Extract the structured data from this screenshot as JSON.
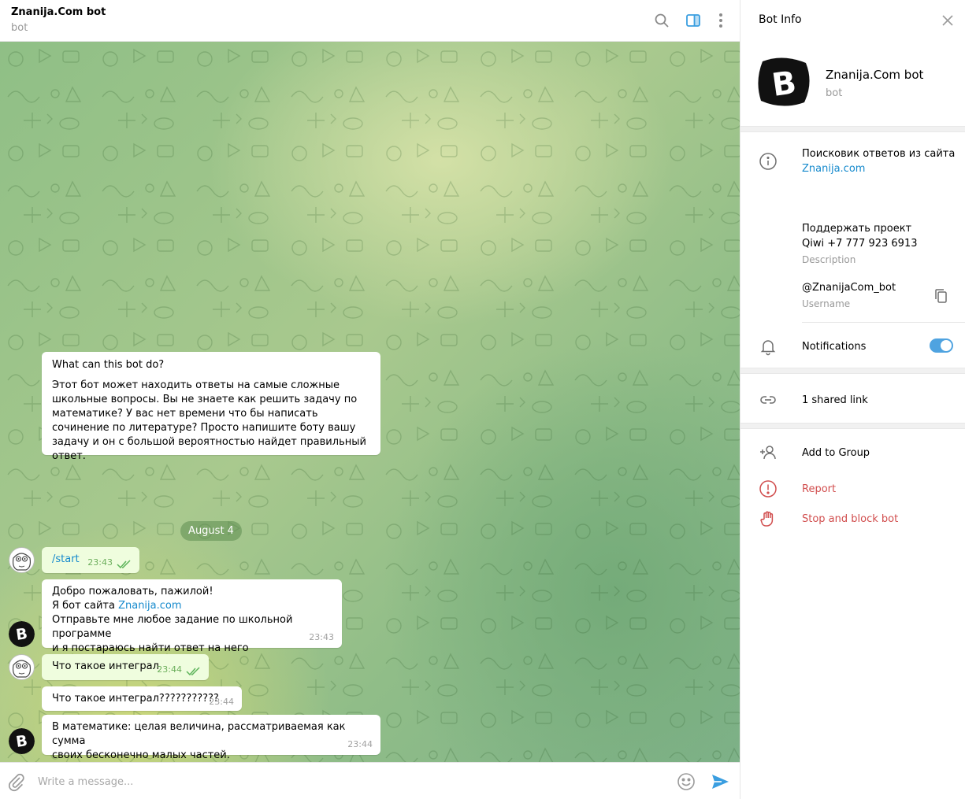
{
  "header": {
    "title": "Znanija.Com bot",
    "subtitle": "bot",
    "icons": [
      "search-icon",
      "sidebar-toggle-icon",
      "more-vertical-icon"
    ]
  },
  "chat": {
    "intro": {
      "title": "What can this bot do?",
      "text": "Этот бот может находить ответы на самые сложные школьные вопросы. Вы не знаете как решить задачу по математике? У вас нет времени что бы написать сочинение по литературе? Просто напишите боту вашу задачу и он с большой вероятностью найдет правильный ответ."
    },
    "date_separator": "August 4",
    "messages": [
      {
        "from": "user",
        "text": "/start",
        "time": "23:43",
        "status": "read"
      },
      {
        "from": "bot",
        "line1": "Добро пожаловать, пажилой!",
        "line2_prefix": "Я бот сайта ",
        "line2_link": "Znanija.com",
        "line3": "Отправьте мне любое задание по школьной программе",
        "line4": "и я постараюсь найти ответ на него",
        "time": "23:43"
      },
      {
        "from": "user",
        "text": "Что такое интеграл",
        "time": "23:44",
        "status": "read"
      },
      {
        "from": "bot",
        "text": "Что такое интеграл???????????",
        "time": "23:44"
      },
      {
        "from": "bot",
        "line1": "В математике: целая величина, рассматриваемая как сумма",
        "line2": "своих бесконечно малых частей.",
        "time": "23:44"
      }
    ]
  },
  "composer": {
    "placeholder": "Write a message...",
    "icons": [
      "attach-icon",
      "emoji-icon",
      "send-icon"
    ]
  },
  "panel": {
    "title": "Bot Info",
    "bot_name": "Znanija.Com bot",
    "bot_subtitle": "bot",
    "about_line1": "Поисковик ответов из сайта",
    "about_link": "Znanija.com",
    "support_line1": "Поддержать проект",
    "support_line2": "Qiwi +7 777 923 6913",
    "description_label": "Description",
    "username": "@ZnanijaCom_bot",
    "username_label": "Username",
    "notifications_label": "Notifications",
    "notifications_on": true,
    "shared_links": "1 shared link",
    "add_to_group": "Add to Group",
    "report": "Report",
    "stop_block": "Stop and block bot",
    "colors": {
      "accent": "#4fa3e0",
      "link": "#168acd",
      "danger": "#d14e4e",
      "outgoing_bubble": "#effdde"
    }
  }
}
